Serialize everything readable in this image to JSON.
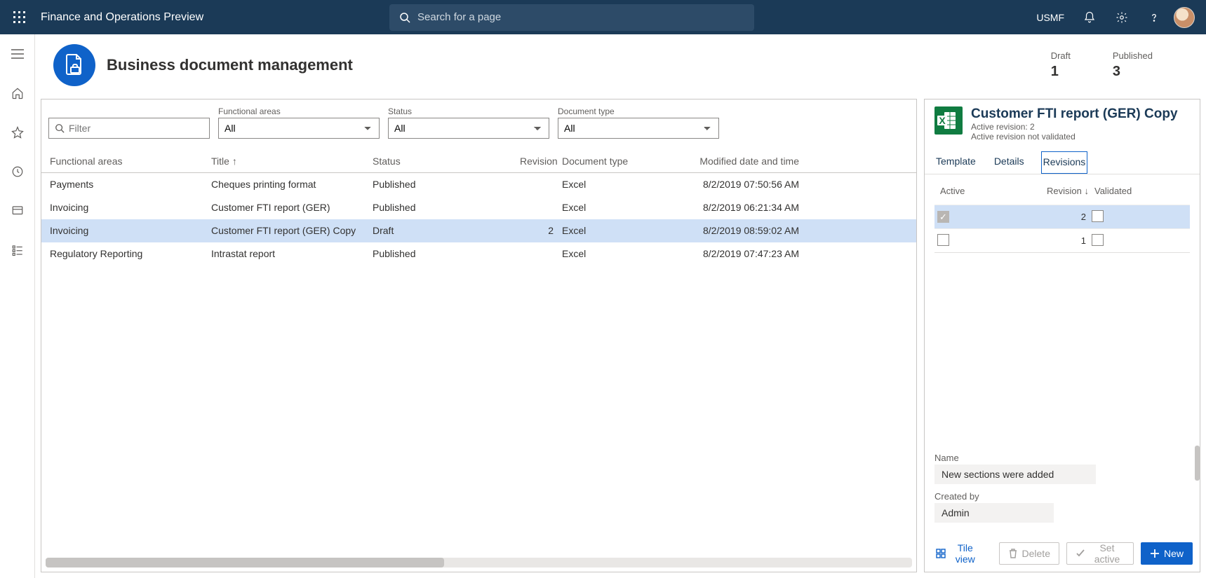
{
  "topbar": {
    "app_title": "Finance and Operations Preview",
    "search_placeholder": "Search for a page",
    "company": "USMF"
  },
  "page": {
    "title": "Business document management",
    "kpis": [
      {
        "label": "Draft",
        "value": "1"
      },
      {
        "label": "Published",
        "value": "3"
      }
    ]
  },
  "filters": {
    "textfilter_placeholder": "Filter",
    "fa_label": "Functional areas",
    "fa_value": "All",
    "status_label": "Status",
    "status_value": "All",
    "dt_label": "Document type",
    "dt_value": "All"
  },
  "grid": {
    "columns": {
      "fa": "Functional areas",
      "title": "Title",
      "status": "Status",
      "revision": "Revision",
      "doctype": "Document type",
      "modified": "Modified date and time"
    },
    "rows": [
      {
        "fa": "Payments",
        "title": "Cheques printing format",
        "status": "Published",
        "revision": "",
        "doctype": "Excel",
        "modified": "8/2/2019 07:50:56 AM",
        "selected": false
      },
      {
        "fa": "Invoicing",
        "title": "Customer FTI report (GER)",
        "status": "Published",
        "revision": "",
        "doctype": "Excel",
        "modified": "8/2/2019 06:21:34 AM",
        "selected": false
      },
      {
        "fa": "Invoicing",
        "title": "Customer FTI report (GER) Copy",
        "status": "Draft",
        "revision": "2",
        "doctype": "Excel",
        "modified": "8/2/2019 08:59:02 AM",
        "selected": true
      },
      {
        "fa": "Regulatory Reporting",
        "title": "Intrastat report",
        "status": "Published",
        "revision": "",
        "doctype": "Excel",
        "modified": "8/2/2019 07:47:23 AM",
        "selected": false
      }
    ]
  },
  "details": {
    "title": "Customer FTI report (GER) Copy",
    "meta1": "Active revision: 2",
    "meta2": "Active revision not validated",
    "tabs": {
      "template": "Template",
      "details": "Details",
      "revisions": "Revisions"
    },
    "rev_columns": {
      "active": "Active",
      "revision": "Revision",
      "validated": "Validated"
    },
    "rev_rows": [
      {
        "active": true,
        "revision": "2",
        "validated": false,
        "selected": true
      },
      {
        "active": false,
        "revision": "1",
        "validated": false,
        "selected": false
      }
    ],
    "name_label": "Name",
    "name_value": "New sections were added",
    "createdby_label": "Created by",
    "createdby_value": "Admin"
  },
  "footer": {
    "tile_view": "Tile view",
    "delete": "Delete",
    "set_active": "Set active",
    "new": "New"
  }
}
